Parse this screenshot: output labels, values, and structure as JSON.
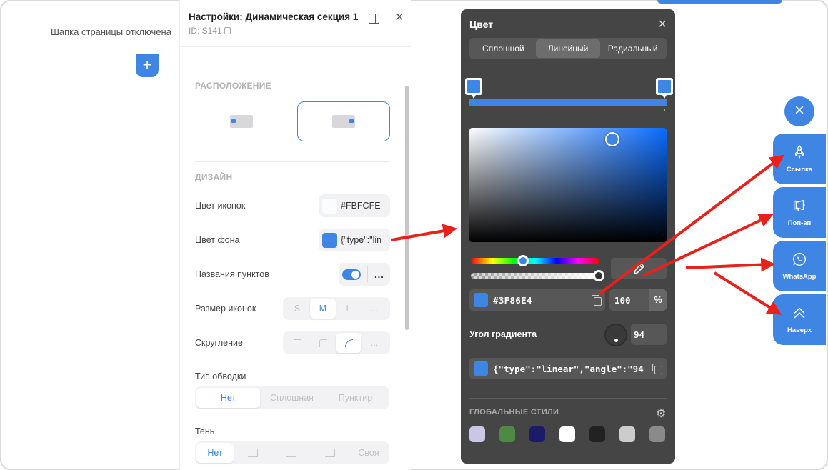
{
  "colors": {
    "accent": "#3f86e4",
    "popup_bg": "#454545",
    "arrow": "#e8211b"
  },
  "page": {
    "header_status": "Шапка страницы отключена",
    "add_button": "+"
  },
  "settings_panel": {
    "title": "Настройки: Динамическая секция 1",
    "id_text": "ID: S141",
    "close": "×",
    "layout_section": "РАСПОЛОЖЕНИЕ",
    "design_section": "ДИЗАЙН",
    "icon_color": {
      "label": "Цвет иконок",
      "value": "#FBFCFE",
      "swatch": "#FBFCFE"
    },
    "bg_color": {
      "label": "Цвет фона",
      "value": "{\"type\":\"lin",
      "swatch": "#3f86e4"
    },
    "item_names": {
      "label": "Названия пунктов",
      "toggle_on": true,
      "more": "..."
    },
    "icon_size": {
      "label": "Размер иконок",
      "options": [
        "S",
        "M",
        "L",
        "..."
      ],
      "selected": "M"
    },
    "rounding": {
      "label": "Скругление",
      "more": "..."
    },
    "stroke_type": {
      "label": "Тип обводки",
      "options": [
        "Нет",
        "Сплошная",
        "Пунктир"
      ],
      "selected": "Нет"
    },
    "shadow": {
      "label": "Тень",
      "options": [
        "Нет",
        "Своя"
      ],
      "selected": "Нет"
    }
  },
  "color_popup": {
    "title": "Цвет",
    "close": "×",
    "tabs": [
      "Сплошной",
      "Линейный",
      "Радиальный"
    ],
    "selected_tab": "Линейный",
    "hex": "#3F86E4",
    "opacity": "100",
    "percent": "%",
    "angle_label": "Угол градиента",
    "angle_value": "94",
    "json_value": "{\"type\":\"linear\",\"angle\":\"94",
    "global_styles_label": "ГЛОБАЛЬНЫЕ СТИЛИ",
    "global_swatches": [
      "#c9c6e6",
      "#4e8a44",
      "#1b1b6b",
      "#ffffff",
      "#222222",
      "#cccccc",
      "#8a8a8a"
    ]
  },
  "floating_buttons": {
    "close": "×",
    "items": [
      {
        "label": "Ссылка",
        "icon": "rocket-icon"
      },
      {
        "label": "Поп-ап",
        "icon": "megaphone-icon"
      },
      {
        "label": "WhatsApp",
        "icon": "whatsapp-icon"
      },
      {
        "label": "Наверх",
        "icon": "double-chevron-up-icon"
      }
    ]
  }
}
